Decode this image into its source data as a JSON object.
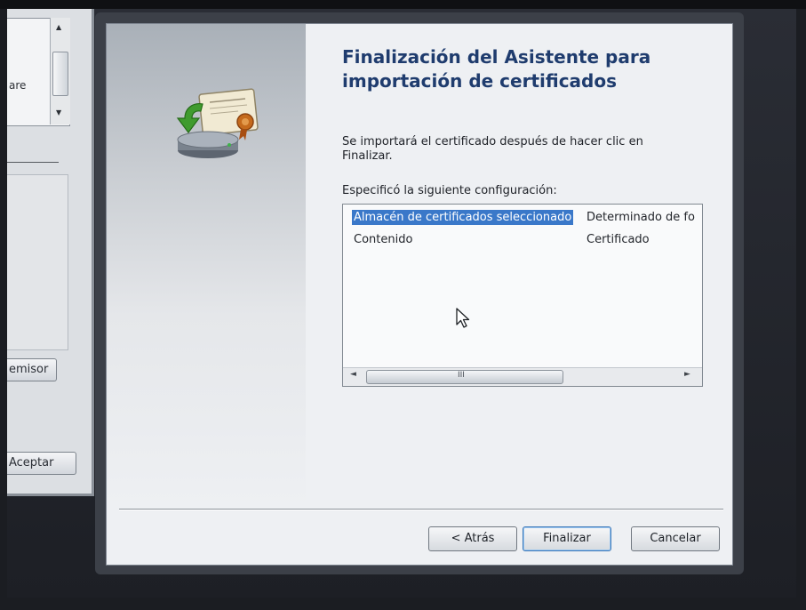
{
  "background_window": {
    "list_fragment": "are",
    "issuer_button_label": "emisor",
    "ok_button_label": "Aceptar"
  },
  "wizard": {
    "title": "Finalización del Asistente para importación de certificados",
    "info_text": "Se importará el certificado después de hacer clic en Finalizar.",
    "config_label": "Especificó la siguiente configuración:",
    "settings": [
      {
        "key": "Almacén de certificados seleccionado",
        "value": "Determinado de fo"
      },
      {
        "key": "Contenido",
        "value": "Certificado"
      }
    ],
    "scrollbar_grip": "III",
    "buttons": {
      "back": "< Atrás",
      "finish": "Finalizar",
      "cancel": "Cancelar"
    }
  },
  "colors": {
    "title": "#1f3c6e",
    "selection": "#3a78c9",
    "certificate_ribbon": "#c56a1c",
    "import_arrow": "#3f9b2e"
  }
}
